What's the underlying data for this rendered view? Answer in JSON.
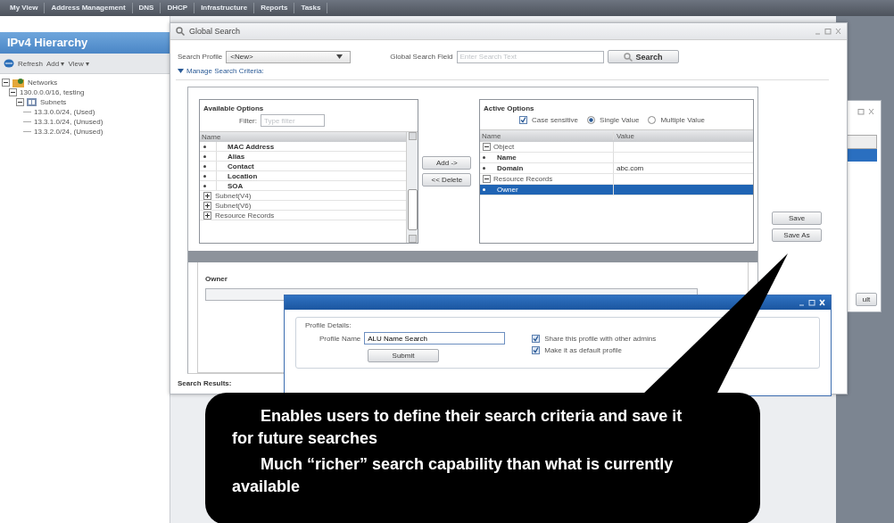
{
  "nav_tabs": [
    {
      "label": "My View",
      "selected": false
    },
    {
      "label": "Address Management",
      "selected": false
    },
    {
      "label": "DNS",
      "selected": false
    },
    {
      "label": "DHCP",
      "selected": false
    },
    {
      "label": "Infrastructure",
      "selected": false
    },
    {
      "label": "Reports",
      "selected": false
    },
    {
      "label": "Tasks",
      "selected": false
    }
  ],
  "sidebar": {
    "title": "IPv4 Hierarchy",
    "toolbar": [
      "Refresh",
      "Add ▾",
      "View ▾"
    ],
    "tree": [
      {
        "label": "Networks",
        "kind": "folder",
        "expanded": true,
        "children": [
          {
            "label": "130.0.0.0/16, testing",
            "expanded": true,
            "children": [
              {
                "label": "Subnets",
                "kind": "subnets",
                "expanded": true,
                "children": [
                  {
                    "label": "13.3.0.0/24, (Used)"
                  },
                  {
                    "label": "13.3.1.0/24, (Unused)"
                  },
                  {
                    "label": "13.3.2.0/24, (Unused)"
                  }
                ]
              }
            ]
          }
        ]
      }
    ]
  },
  "back_window": {
    "button": "ult"
  },
  "global_search": {
    "title": "Global Search",
    "profile_label": "Search Profile",
    "profile_value": "<New>",
    "field_label": "Global Search Field",
    "field_placeholder": "Enter Search Text",
    "search_button": "Search",
    "criteria_toggle": "Manage Search Criteria:",
    "criteria_expanded": true,
    "available": {
      "title": "Available Options",
      "filter_label": "Filter:",
      "filter_placeholder": "Type filter",
      "column": "Name",
      "rows": [
        {
          "kind": "field",
          "label": "MAC Address"
        },
        {
          "kind": "field",
          "label": "Alias"
        },
        {
          "kind": "field",
          "label": "Contact"
        },
        {
          "kind": "field",
          "label": "Location"
        },
        {
          "kind": "field",
          "label": "SOA"
        },
        {
          "kind": "group",
          "label": "Subnet(V4)",
          "expanded": false
        },
        {
          "kind": "group",
          "label": "Subnet(V6)",
          "expanded": false
        },
        {
          "kind": "group",
          "label": "Resource Records",
          "expanded": false
        }
      ]
    },
    "add_button": "Add ->",
    "delete_button": "<< Delete",
    "active": {
      "title": "Active Options",
      "case_sensitive": {
        "label": "Case sensitive",
        "checked": true
      },
      "modes": [
        {
          "label": "Single Value",
          "selected": true
        },
        {
          "label": "Multiple Value",
          "selected": false
        }
      ],
      "columns": [
        "Name",
        "Value"
      ],
      "rows": [
        {
          "kind": "group",
          "label": "Object",
          "expanded": true,
          "selected": false
        },
        {
          "kind": "field",
          "label": "Name",
          "selected": false
        },
        {
          "kind": "field",
          "label": "Domain",
          "value": "abc.com",
          "selected": false
        },
        {
          "kind": "group",
          "label": "Resource Records",
          "expanded": true,
          "selected": false
        },
        {
          "kind": "field",
          "label": "Owner",
          "selected": true
        }
      ]
    },
    "save_button": "Save",
    "save_as_button": "Save As",
    "owner_label": "Owner",
    "results_label": "Search Results:"
  },
  "profile_dialog": {
    "legend": "Profile Details:",
    "name_label": "Profile Name",
    "name_value": "ALU Name Search",
    "submit": "Submit",
    "options": [
      {
        "label": "Share this profile with other admins",
        "checked": true
      },
      {
        "label": "Make it as default profile",
        "checked": true
      }
    ]
  },
  "callout": {
    "paragraphs": [
      "Enables users to define their search criteria and save it for future searches",
      "Much “richer” search capability than what is currently available"
    ]
  }
}
